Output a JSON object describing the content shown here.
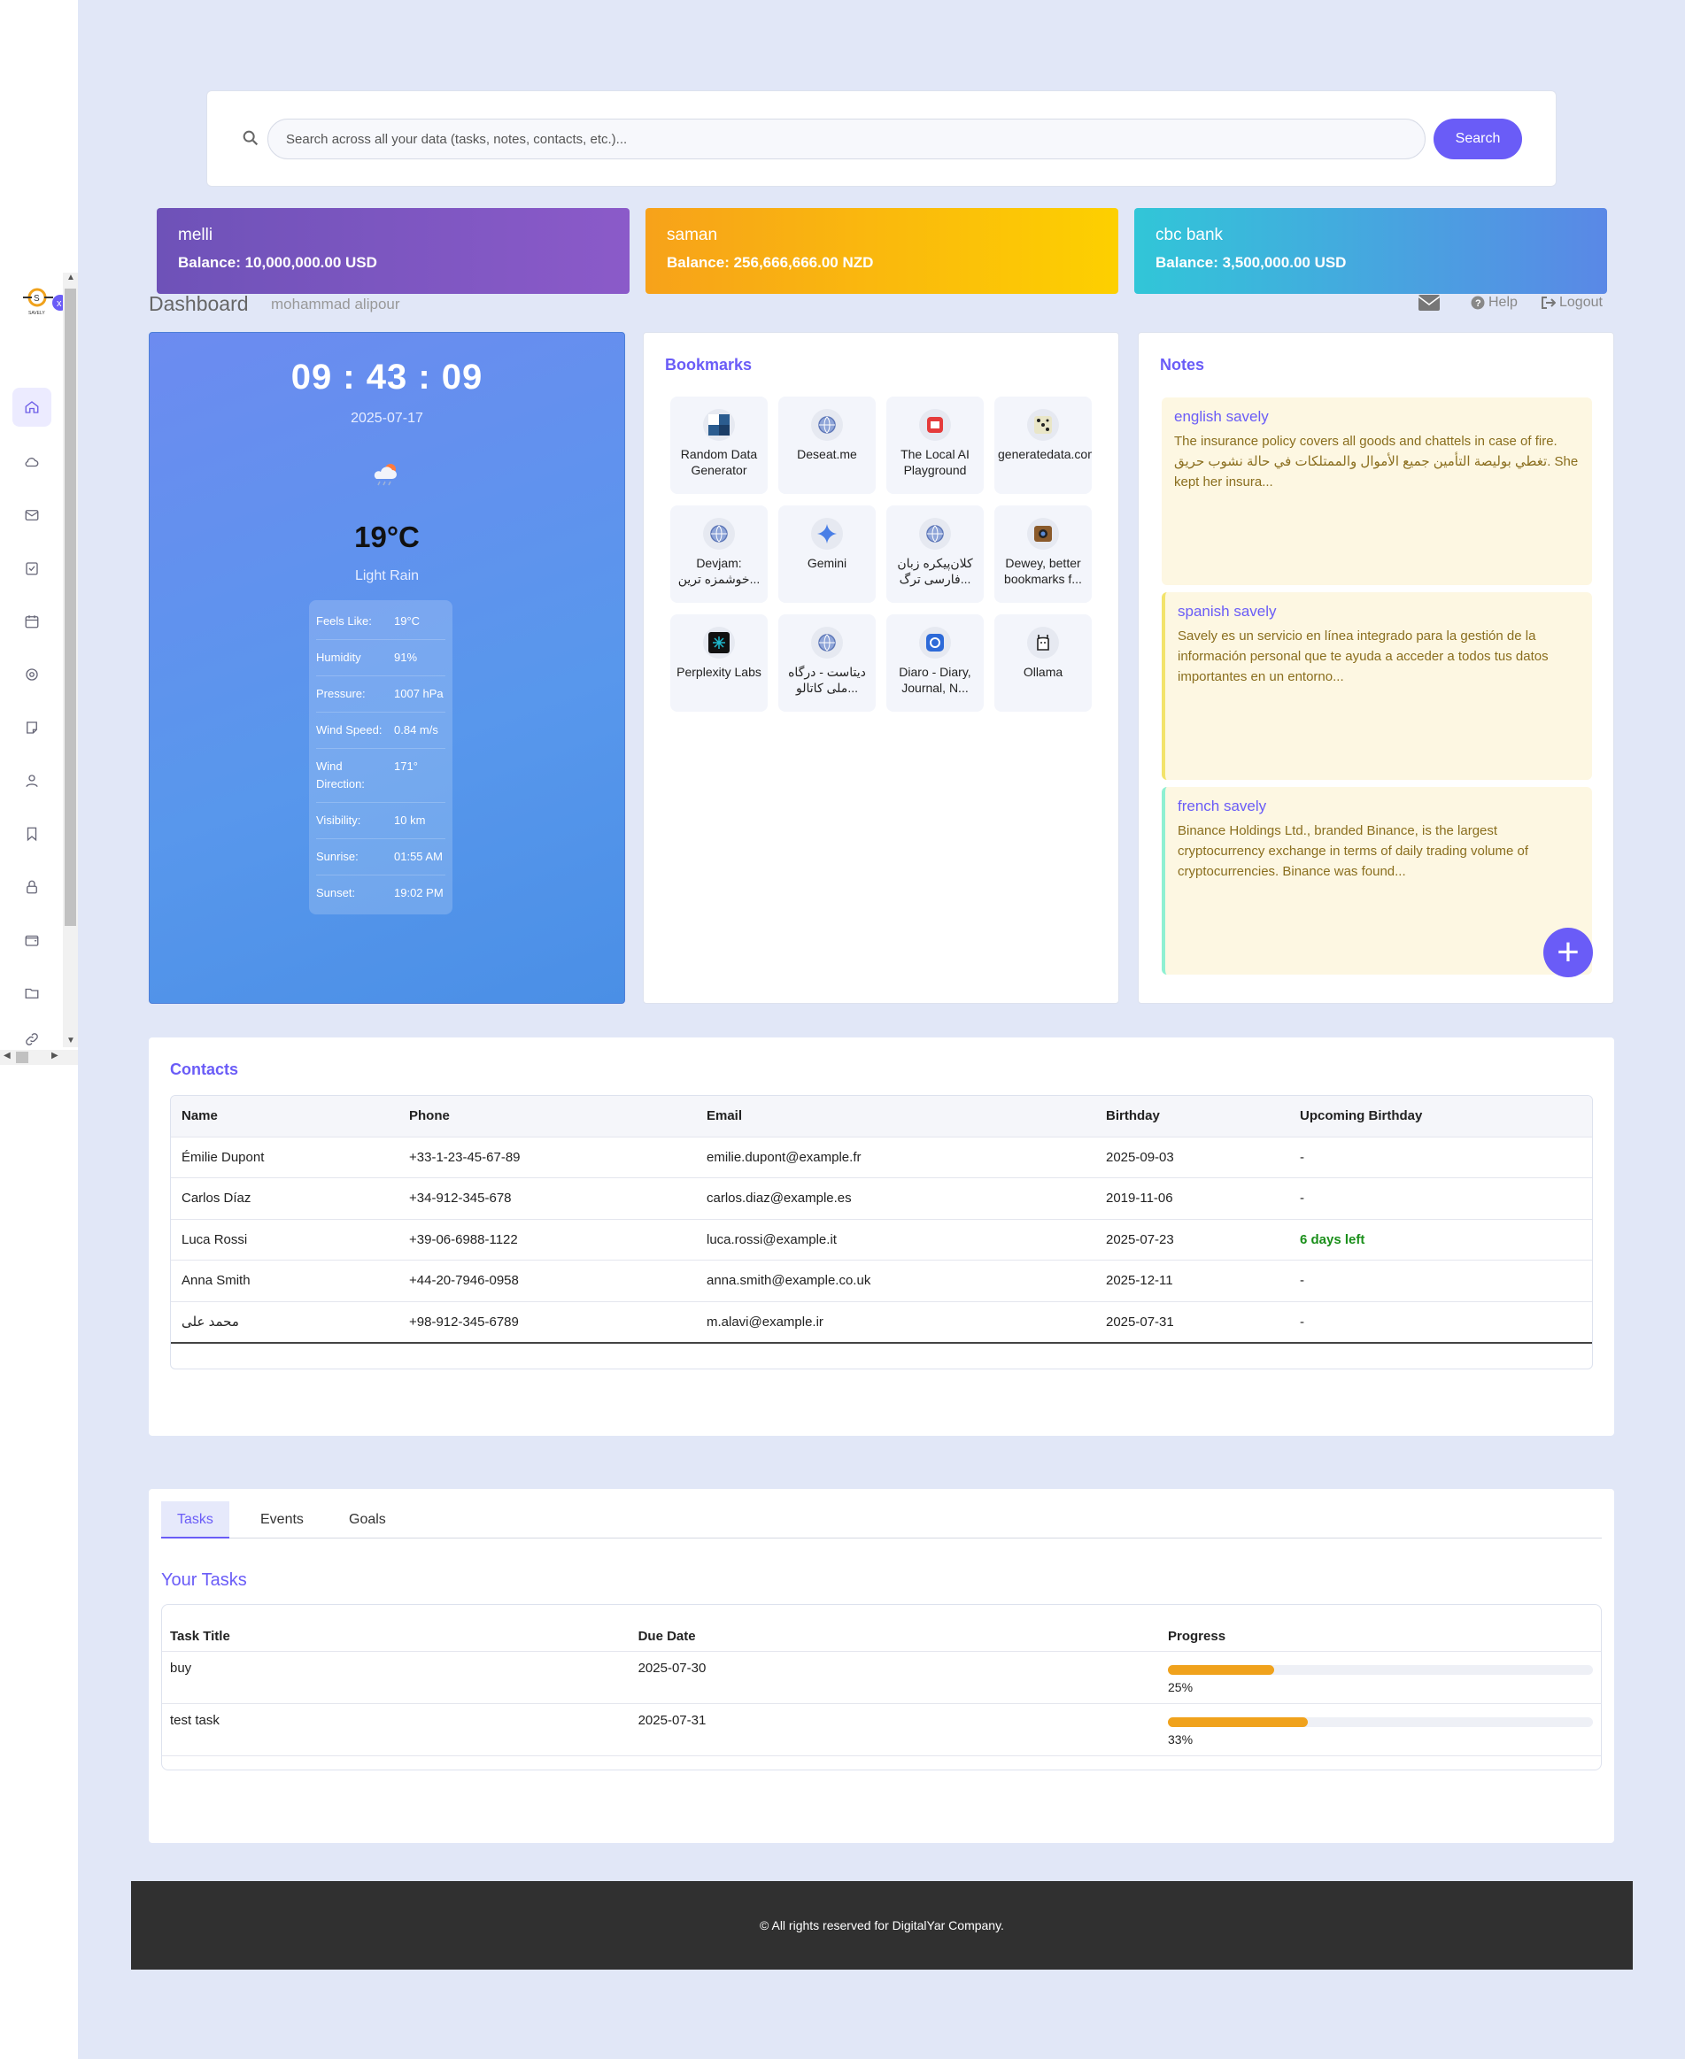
{
  "sidebar": {
    "nav": [
      {
        "icon": "home-icon",
        "active": true
      },
      {
        "icon": "cloud-icon"
      },
      {
        "icon": "mail-icon"
      },
      {
        "icon": "task-check-icon"
      },
      {
        "icon": "calendar-icon"
      },
      {
        "icon": "target-icon"
      },
      {
        "icon": "note-icon"
      },
      {
        "icon": "user-icon"
      },
      {
        "icon": "bookmark-icon"
      },
      {
        "icon": "lock-icon"
      },
      {
        "icon": "wallet-icon"
      },
      {
        "icon": "folder-icon"
      },
      {
        "icon": "link-icon"
      }
    ]
  },
  "search": {
    "placeholder": "Search across all your data (tasks, notes, contacts, etc.)...",
    "button_label": "Search"
  },
  "banks": [
    {
      "name": "melli",
      "balance": "Balance: 10,000,000.00 USD"
    },
    {
      "name": "saman",
      "balance": "Balance: 256,666,666.00 NZD"
    },
    {
      "name": "cbc bank",
      "balance": "Balance: 3,500,000.00 USD"
    }
  ],
  "header": {
    "title": "Dashboard",
    "user": "mohammad alipour",
    "help_label": "Help",
    "logout_label": "Logout"
  },
  "weather": {
    "time": "09 : 43 : 09",
    "date": "2025-07-17",
    "temp": "19°C",
    "desc": "Light Rain",
    "icon": "cloud-rain-icon",
    "details": [
      {
        "k": "Feels Like:",
        "v": "19°C"
      },
      {
        "k": "Humidity",
        "v": "91%"
      },
      {
        "k": "Pressure:",
        "v": "1007 hPa"
      },
      {
        "k": "Wind Speed:",
        "v": "0.84 m/s"
      },
      {
        "k": "Wind Direction:",
        "v": "171°"
      },
      {
        "k": "Visibility:",
        "v": "10 km"
      },
      {
        "k": "Sunrise:",
        "v": "01:55 AM"
      },
      {
        "k": "Sunset:",
        "v": "19:02 PM"
      }
    ]
  },
  "bookmarks": {
    "title": "Bookmarks",
    "items": [
      {
        "label": "Random Data Generator"
      },
      {
        "label": "Deseat.me"
      },
      {
        "label": "The Local AI Playground"
      },
      {
        "label": "generatedata.com"
      },
      {
        "label": "Devjam: خوشمزه ترین..."
      },
      {
        "label": "Gemini"
      },
      {
        "label": "کلان‌پیکره زبان فارسی ترگ..."
      },
      {
        "label": "Dewey, better bookmarks f..."
      },
      {
        "label": "Perplexity Labs"
      },
      {
        "label": "دیتاست - درگاه ملی کاتالو..."
      },
      {
        "label": "Diaro - Diary, Journal, N..."
      },
      {
        "label": "Ollama"
      }
    ]
  },
  "notes": {
    "title": "Notes",
    "items": [
      {
        "title": "english savely",
        "body": "The insurance policy covers all goods and chattels in case of fire. تغطي بوليصة التأمين جميع الأموال والممتلكات في حالة نشوب حريق. She kept her insura..."
      },
      {
        "title": "spanish savely",
        "body": "Savely es un servicio en línea integrado para la gestión de la información personal que te ayuda a acceder a todos tus datos importantes en un entorno..."
      },
      {
        "title": "french savely",
        "body": "Binance Holdings Ltd., branded Binance, is the largest cryptocurrency exchange in terms of daily trading volume of cryptocurrencies. Binance was found..."
      }
    ],
    "fab_label": "+"
  },
  "contacts": {
    "title": "Contacts",
    "columns": [
      "Name",
      "Phone",
      "Email",
      "Birthday",
      "Upcoming Birthday"
    ],
    "rows": [
      [
        "Émilie Dupont",
        "+33-1-23-45-67-89",
        "emilie.dupont@example.fr",
        "2025-09-03",
        "-"
      ],
      [
        "Carlos Díaz",
        "+34-912-345-678",
        "carlos.diaz@example.es",
        "2019-11-06",
        "-"
      ],
      [
        "Luca Rossi",
        "+39-06-6988-1122",
        "luca.rossi@example.it",
        "2025-07-23",
        "6 days left"
      ],
      [
        "Anna Smith",
        "+44-20-7946-0958",
        "anna.smith@example.co.uk",
        "2025-12-11",
        "-"
      ],
      [
        "محمد علی",
        "+98-912-345-6789",
        "m.alavi@example.ir",
        "2025-07-31",
        "-"
      ]
    ]
  },
  "tasks": {
    "tabs": [
      "Tasks",
      "Events",
      "Goals"
    ],
    "heading": "Your Tasks",
    "columns": [
      "Task Title",
      "Due Date",
      "Progress"
    ],
    "rows": [
      {
        "title": "buy",
        "due": "2025-07-30",
        "progress": 25,
        "progress_label": "25%"
      },
      {
        "title": "test task",
        "due": "2025-07-31",
        "progress": 33,
        "progress_label": "33%"
      }
    ]
  },
  "footer": {
    "text": "© All rights reserved for DigitalYar Company."
  },
  "colors": {
    "accent": "#6a5cf7",
    "progress": "#f0a21c",
    "birthday_soon": "#1a8f1a"
  }
}
